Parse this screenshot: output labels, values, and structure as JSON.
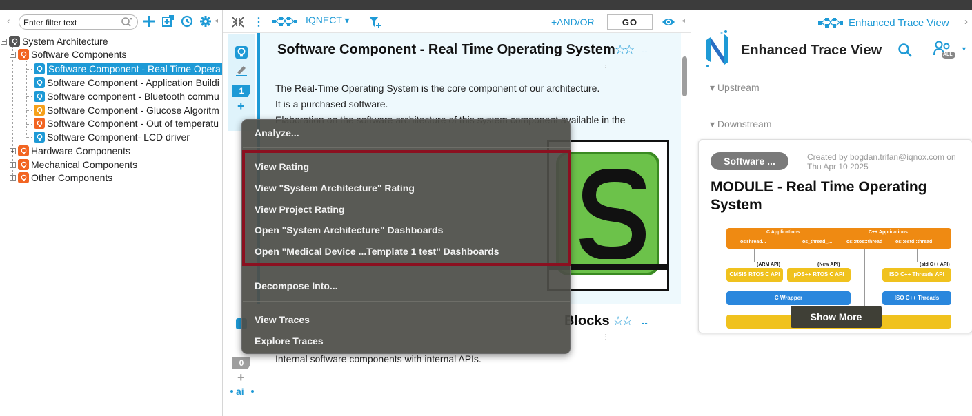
{
  "left": {
    "filter_placeholder": "Enter filter text",
    "tree": [
      {
        "label": "System Architecture"
      },
      {
        "label": "Software Components"
      },
      {
        "label": "Software Component - Real Time Opera"
      },
      {
        "label": "Software Component - Application Buildi"
      },
      {
        "label": "Software component - Bluetooth commu"
      },
      {
        "label": "Software Component - Glucose Algoritm"
      },
      {
        "label": "Software Component - Out of temperatu"
      },
      {
        "label": "Software Component- LCD driver"
      },
      {
        "label": "Hardware Components"
      },
      {
        "label": "Mechanical Components"
      },
      {
        "label": "Other Components"
      }
    ],
    "expander_minus": "−",
    "expander_plus": "+"
  },
  "middle": {
    "project_label": "IQNECT ▾",
    "andor_label": "+AND/OR",
    "go_label": "GO",
    "component1": {
      "title": "Software Component - Real Time Operating System",
      "stars": "☆☆",
      "rating": "--",
      "desc_lines": [
        "The Real-Time Operating System is the core component of our architecture.",
        "It is a purchased software.",
        "Elaboration on the software architecture of this system component available in the"
      ],
      "count": "1"
    },
    "component2": {
      "title_partial": "Blocks",
      "stars": "☆☆",
      "rating": "--",
      "desc": "Internal software components with internal APIs.",
      "count": "0"
    }
  },
  "context_menu": {
    "items": [
      "Analyze...",
      "View Rating",
      "View \"System Architecture\" Rating",
      "View Project Rating",
      "Open \"System Architecture\" Dashboards",
      "Open \"Medical Device ...Template 1 test\" Dashboards",
      "Decompose Into...",
      "View Traces",
      "Explore Traces"
    ]
  },
  "right": {
    "header_title": "Enhanced Trace View",
    "title": "Enhanced Trace View",
    "all_badge": "ALL",
    "upstream": "▾  Upstream",
    "downstream": "▾  Downstream",
    "card": {
      "badge": "Software ...",
      "created": "Created by bogdan.trifan@iqnox.com on Thu Apr 10 2025",
      "title": "MODULE - Real Time Operating System",
      "show_more": "Show More",
      "diagram": {
        "c_apps": "C Applications",
        "cpp_apps": "C++ Applications",
        "osthread": "osThread...",
        "os_thread": "os_thread_...",
        "os_rtos": "os::rtos::thread",
        "os_estd": "os::estd::thread",
        "arm_api": "(ARM API)",
        "new_api": "(New API)",
        "std_api": "(std C++ API)",
        "cmsis": "CMSIS RTOS C API",
        "uos": "µOS++ RTOS C API",
        "iso_api": "ISO C++ Threads API",
        "c_wrapper": "C Wrapper",
        "iso_threads": "ISO C++ Threads"
      }
    }
  },
  "colors": {
    "accent": "#1e9ad6",
    "menu_bg": "#4e4e48",
    "highlight_border": "#8b1020",
    "orange_node": "#f26522"
  }
}
